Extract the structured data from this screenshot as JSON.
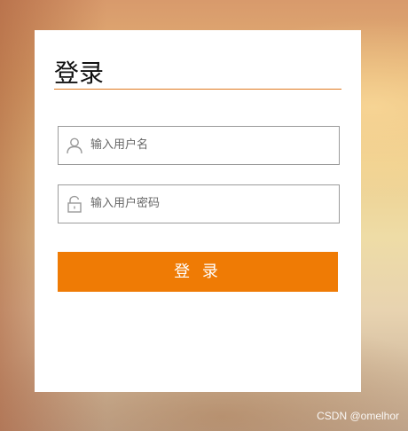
{
  "login": {
    "title": "登录",
    "username": {
      "placeholder": "输入用户名",
      "icon": "user-icon"
    },
    "password": {
      "placeholder": "输入用户密码",
      "icon": "unlock-icon"
    },
    "submit_label": "登 录"
  },
  "watermark": "CSDN @omelhor",
  "colors": {
    "accent": "#ef7b05",
    "title_underline": "#e0791f",
    "field_border": "#9b9b9b"
  }
}
